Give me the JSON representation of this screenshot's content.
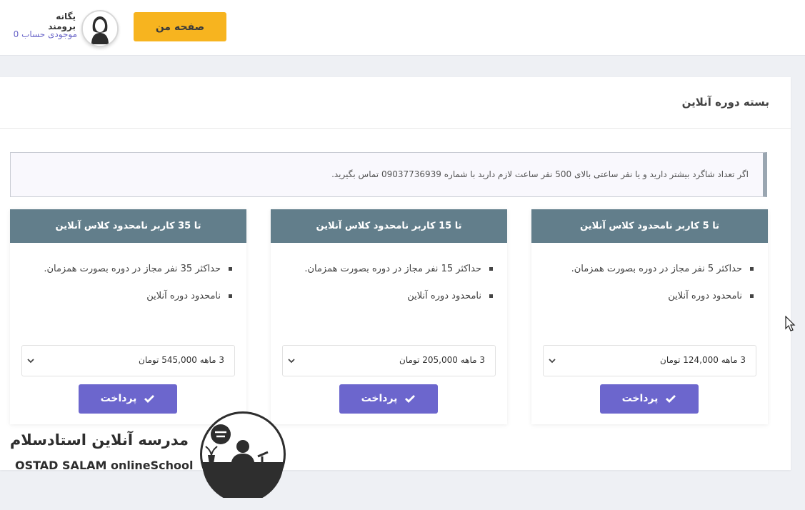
{
  "header": {
    "user_name": "یگانه برومند",
    "balance": "موجودی حساب 0",
    "my_page_label": "صفحه من"
  },
  "panel": {
    "title": "بسته دوره آنلاین",
    "notice": "اگر تعداد شاگرد بیشتر دارید و یا نفر ساعتی بالای 500 نفر ساعت لازم دارید با شماره 09037736939 تماس بگیرید."
  },
  "plans": [
    {
      "title": "تا 5 کاربر نامحدود کلاس آنلاین",
      "features": [
        "حداکثر 5 نفر مجاز در دوره بصورت همزمان.",
        "نامحدود دوره آنلاین"
      ],
      "selected_option": "3 ماهه 124,000 تومان",
      "pay_label": "پرداخت"
    },
    {
      "title": "تا 15 کاربر نامحدود کلاس آنلاین",
      "features": [
        "حداکثر 15 نفر مجاز در دوره بصورت همزمان.",
        "نامحدود دوره آنلاین"
      ],
      "selected_option": "3 ماهه 205,000 تومان",
      "pay_label": "پرداخت"
    },
    {
      "title": "تا 35 کاربر نامحدود کلاس آنلاین",
      "features": [
        "حداکثر 35 نفر مجاز در دوره بصورت همزمان.",
        "نامحدود دوره آنلاین"
      ],
      "selected_option": "3 ماهه 545,000 تومان",
      "pay_label": "پرداخت"
    }
  ],
  "watermark": {
    "title": "مدرسه آنلاین استادسلام",
    "subtitle": "OSTAD SALAM onlineSchool"
  },
  "icons": {
    "avatar": "user-avatar-icon",
    "select": "chevron-down-icon",
    "pay": "check-icon",
    "cursor": "mouse-pointer-icon",
    "logo": "school-emblem-icon"
  },
  "colors": {
    "my_page_button": "#f7b41f",
    "card_header": "#627e8b",
    "pay_button": "#6c66cd",
    "balance_text": "#6b67c9",
    "notice_border": "#9aa6b1"
  }
}
